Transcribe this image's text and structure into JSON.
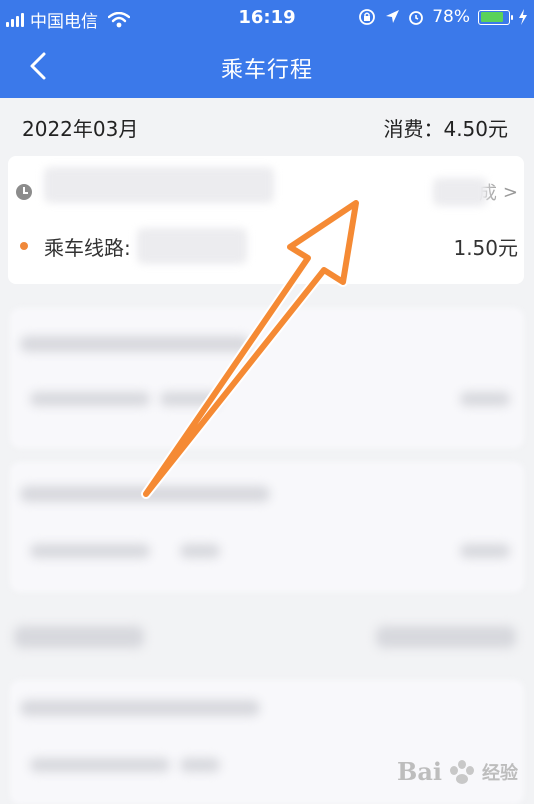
{
  "status_bar": {
    "carrier": "中国电信",
    "time": "16:19",
    "battery_percent": "78%",
    "colors": {
      "background": "#3b79ea",
      "battery_fill": "#5ad25a"
    }
  },
  "nav": {
    "title": "乘车行程",
    "back_icon": "chevron-left-icon"
  },
  "summary": {
    "month": "2022年03月",
    "spend_label": "消费：",
    "spend_value": "4.50元"
  },
  "trip": {
    "route_label": "乘车线路:",
    "amount": "1.50元",
    "chevron": ">",
    "status_partial": "成",
    "dot_color": "#f0883a"
  },
  "annotation": {
    "arrow_color": "#f58a34"
  },
  "watermark": {
    "brand": "Bai",
    "brand_suffix": "经验"
  }
}
